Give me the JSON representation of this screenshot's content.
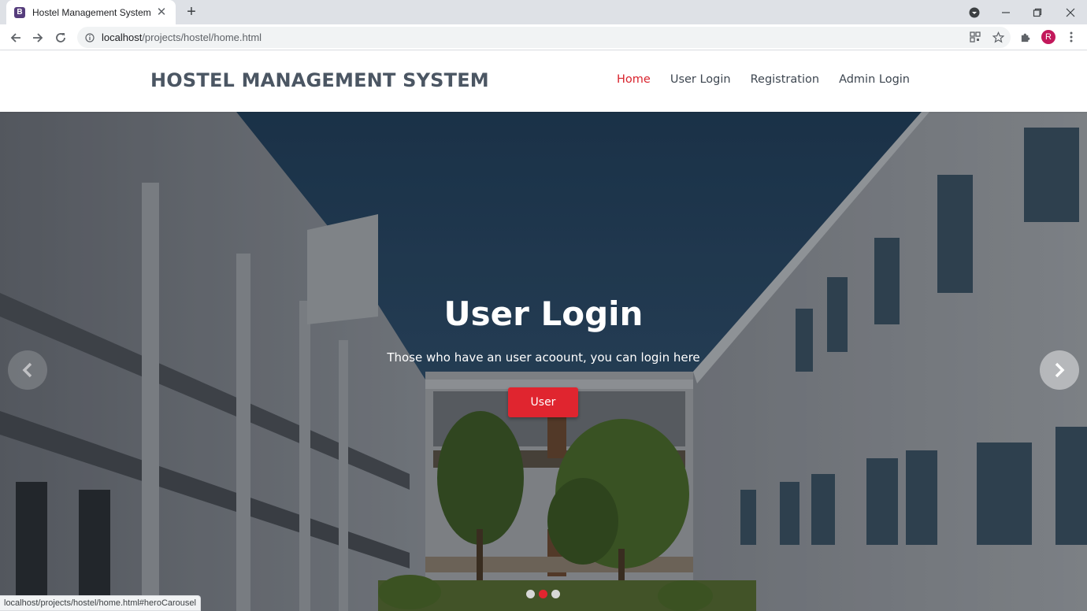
{
  "browser": {
    "tab_title": "Hostel Management System",
    "tab_favicon_letter": "B",
    "url_host": "localhost",
    "url_path": "/projects/hostel/home.html",
    "profile_initial": "R",
    "status_url": "localhost/projects/hostel/home.html#heroCarousel"
  },
  "header": {
    "brand": "HOSTEL MANAGEMENT SYSTEM",
    "nav": {
      "home": "Home",
      "user_login": "User Login",
      "registration": "Registration",
      "admin_login": "Admin Login"
    }
  },
  "hero": {
    "title": "User Login",
    "text": "Those who have an user acoount, you can login here",
    "button_label": "User",
    "active_slide": 2,
    "slide_count": 3
  },
  "colors": {
    "accent": "#e0252f",
    "brand_text": "#4b5663"
  }
}
